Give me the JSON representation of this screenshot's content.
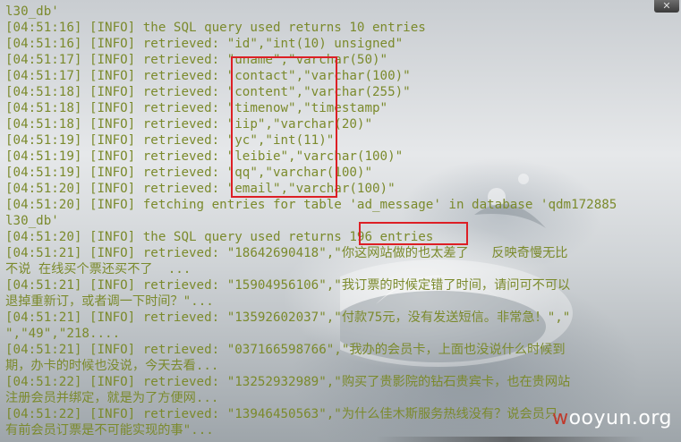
{
  "terminal": {
    "lines": [
      "l30_db'",
      "[04:51:16] [INFO] the SQL query used returns 10 entries",
      "[04:51:16] [INFO] retrieved: \"id\",\"int(10) unsigned\"",
      "[04:51:17] [INFO] retrieved: \"uname\",\"varchar(50)\"",
      "[04:51:17] [INFO] retrieved: \"contact\",\"varchar(100)\"",
      "[04:51:18] [INFO] retrieved: \"content\",\"varchar(255)\"",
      "[04:51:18] [INFO] retrieved: \"timenow\",\"timestamp\"",
      "[04:51:18] [INFO] retrieved: \"iip\",\"varchar(20)\"",
      "[04:51:19] [INFO] retrieved: \"yc\",\"int(11)\"",
      "[04:51:19] [INFO] retrieved: \"leibie\",\"varchar(100)\"",
      "[04:51:19] [INFO] retrieved: \"qq\",\"varchar(100)\"",
      "[04:51:20] [INFO] retrieved: \"email\",\"varchar(100)\"",
      "[04:51:20] [INFO] fetching entries for table 'ad_message' in database 'qdm172885",
      "l30_db'",
      "[04:51:20] [INFO] the SQL query used returns 196 entries",
      "[04:51:21] [INFO] retrieved: \"18642690418\",\"你这网站做的也太差了   反映奇慢无比",
      "不说 在线买个票还买不了  ...",
      "[04:51:21] [INFO] retrieved: \"15904956106\",\"我订票的时候定错了时间，请问可不可以",
      "退掉重新订，或者调一下时间？\"...",
      "[04:51:21] [INFO] retrieved: \"13592602037\",\"付款75元，没有发送短信。非常急！\",\"",
      "\",\"49\",\"218....",
      "[04:51:21] [INFO] retrieved: \"037166598766\",\"我办的会员卡，上面也没说什么时候到",
      "期，办卡的时候也没说，今天去看...",
      "[04:51:22] [INFO] retrieved: \"13252932989\",\"购买了贵影院的钻石贵宾卡，也在贵网站",
      "注册会员并绑定，就是为了方便网...",
      "[04:51:22] [INFO] retrieved: \"13946450563\",\"为什么佳木斯服务热线没有？说会员只",
      "有前会员订票是不可能实现的事\"..."
    ]
  },
  "window": {
    "close_label": "✕"
  },
  "watermark": {
    "prefix": "w",
    "rest": "ooyun.org"
  },
  "colors": {
    "text": "#7b8a2c",
    "highlight_border": "#dd1f25"
  }
}
